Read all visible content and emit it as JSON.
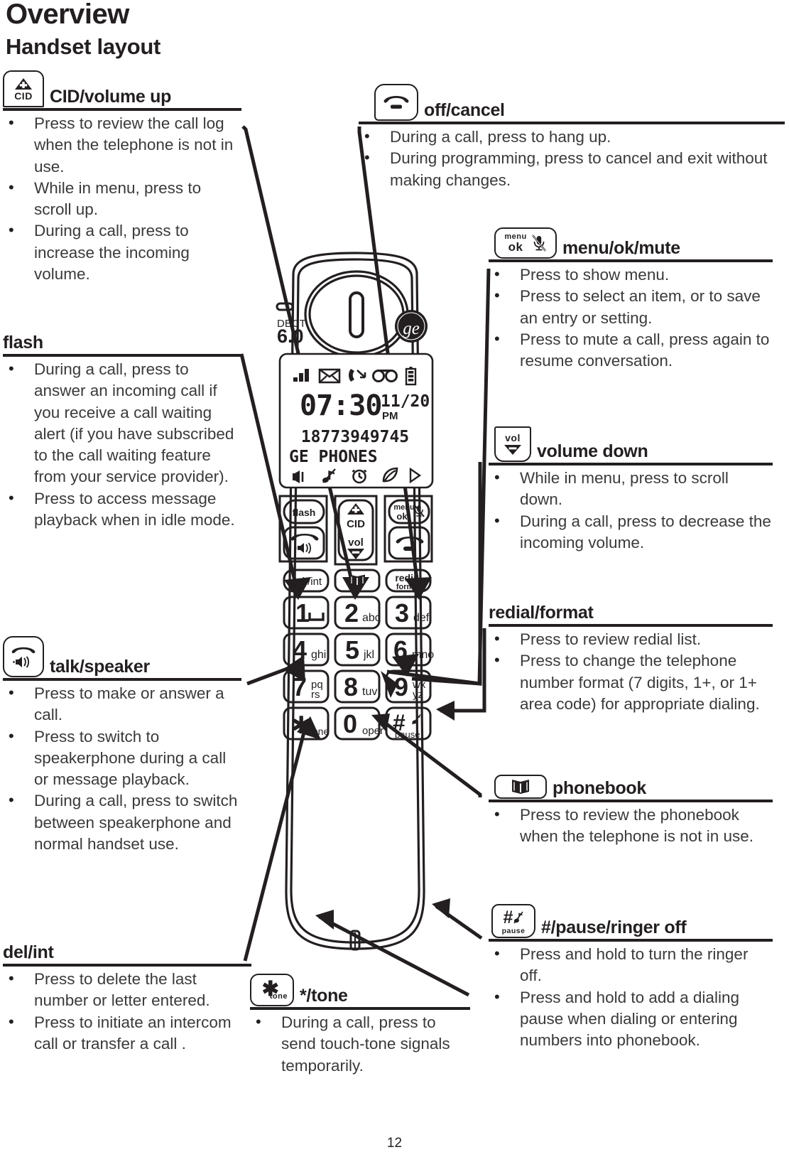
{
  "page": {
    "title": "Overview",
    "subtitle": "Handset layout",
    "page_number": "12"
  },
  "callouts": [
    {
      "id": "cid-volume-up",
      "title": "CID/volume up",
      "key_label": "CID",
      "bullets": [
        "Press to review the call log when the telephone is not in use.",
        "While in menu, press to scroll up.",
        "During a call, press to increase the incoming volume."
      ]
    },
    {
      "id": "flash",
      "title": "flash",
      "key_label": "",
      "bullets": [
        "During a call, press to answer an incoming call if you receive a call waiting alert (if you have subscribed to the call waiting feature from your service provider).",
        "Press to access message playback when in idle mode."
      ]
    },
    {
      "id": "talk-speaker",
      "title": "talk/speaker",
      "key_label": "",
      "bullets": [
        "Press to make or answer a call.",
        "Press to switch to speakerphone during a call or message playback.",
        "During a call, press to switch between speakerphone and normal handset use."
      ]
    },
    {
      "id": "del-int",
      "title": "del/int",
      "key_label": "",
      "bullets": [
        "Press to delete the last number or letter entered.",
        "Press to initiate an intercom call or transfer a call ."
      ]
    },
    {
      "id": "off-cancel",
      "title": "off/cancel",
      "key_label": "",
      "bullets": [
        "During a call, press to hang up.",
        "During programming, press to cancel and exit without making changes."
      ]
    },
    {
      "id": "menu-ok-mute",
      "title": "menu/ok/mute",
      "key_label_top": "menu",
      "key_label_bottom": "ok",
      "bullets": [
        "Press to show menu.",
        "Press to select an item, or to save an entry or setting.",
        "Press to mute a call, press again to resume conversation."
      ]
    },
    {
      "id": "volume-down",
      "title": "volume down",
      "key_label": "vol",
      "bullets": [
        "While in menu, press to scroll down.",
        "During a call, press to decrease the incoming volume."
      ]
    },
    {
      "id": "redial-format",
      "title": "redial/format",
      "key_label": "",
      "bullets": [
        "Press to review redial list.",
        "Press to change the telephone number format (7 digits, 1+, or 1+ area code) for appropriate dialing."
      ]
    },
    {
      "id": "phonebook",
      "title": "phonebook",
      "key_label": "",
      "bullets": [
        "Press to review the phonebook when the telephone is not in use."
      ]
    },
    {
      "id": "pause-ringer-off",
      "title": "#/pause/ringer off",
      "key_label": "pause",
      "bullets": [
        "Press and hold to turn the ringer off.",
        "Press and hold to add a dialing pause when dialing or entering numbers into phonebook."
      ]
    },
    {
      "id": "star-tone",
      "title": "*/tone",
      "key_label": "tone",
      "bullets": [
        "During a call, press to send touch-tone signals temporarily."
      ]
    }
  ],
  "handset": {
    "brand_logo": "ge-logo",
    "dect_line1": "DECT",
    "dect_line2": "6.0",
    "lcd": {
      "status_icons": [
        "signal-bars-icon",
        "envelope-icon",
        "missed-call-icon",
        "voicemail-icon",
        "battery-icon"
      ],
      "time": "07:30",
      "ampm": "PM",
      "date": "11/20",
      "caller_number": "18773949745",
      "caller_name": "GE PHONES",
      "bottom_icons": [
        "speaker-icon",
        "music-note-icon",
        "alarm-clock-icon",
        "leaf-icon",
        "play-arrow-icon"
      ]
    },
    "soft_keys": {
      "flash": "flash",
      "cid": "CID",
      "vol": "vol",
      "menu_top": "menu",
      "menu_bottom": "ok"
    },
    "function_keys": {
      "del_int": "del /int",
      "phonebook": "phonebook-icon",
      "redial_top": "redial",
      "redial_bottom": "format"
    },
    "keypad": [
      {
        "digit": "1",
        "letters": "␣"
      },
      {
        "digit": "2",
        "letters": "abc"
      },
      {
        "digit": "3",
        "letters": "def"
      },
      {
        "digit": "4",
        "letters": "ghi"
      },
      {
        "digit": "5",
        "letters": "jkl"
      },
      {
        "digit": "6",
        "letters": "mno"
      },
      {
        "digit": "7",
        "letters": "pq\nrs"
      },
      {
        "digit": "8",
        "letters": "tuv"
      },
      {
        "digit": "9",
        "letters": "wx\nyz"
      },
      {
        "digit": "✱",
        "letters": "tone"
      },
      {
        "digit": "0",
        "letters": "oper"
      },
      {
        "digit": "#",
        "letters": "pause"
      }
    ]
  },
  "colors": {
    "ink": "#231f20",
    "body_text": "#3a3a3a",
    "paper": "#ffffff"
  }
}
